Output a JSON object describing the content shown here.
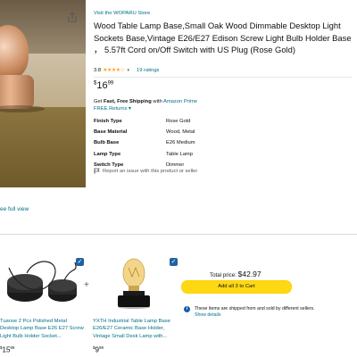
{
  "product": {
    "store_link": "Visit the WOPARU Store",
    "title": "Wood Table Lamp Base,Small Oak Wood Dimmable Desktop Light Sockets Base,Vintage E26/E27 Edison Screw Light Bulb Holder Base ， 5.57ft Cord on/Off Switch with US Plug (Rose Gold)",
    "rating_value": "3.8",
    "rating_stars": "★★★★☆",
    "rating_fraction": 0.76,
    "ratings_count": "19 ratings",
    "price": {
      "symbol": "$",
      "whole": "16",
      "cents": "99"
    },
    "delivery_prefix": "Get ",
    "delivery_bold": "Fast, Free Shipping",
    "delivery_mid": " with ",
    "delivery_prime": "Amazon Prime",
    "returns": "FREE Returns ▾",
    "specs": [
      {
        "key": "Finish Type",
        "value": "Rose Gold"
      },
      {
        "key": "Base Material",
        "value": "Wood, Metal"
      },
      {
        "key": "Bulb Base",
        "value": "E26 Medium"
      },
      {
        "key": "Lamp Type",
        "value": "Table Lamp"
      },
      {
        "key": "Switch Type",
        "value": "Dimmer"
      }
    ],
    "report_issue": "Report an issue with this product or seller",
    "see_full_view": "ee full view"
  },
  "fbt": {
    "items": [
      {
        "title": "Tuanse 2 Pcs Polished Metal Desktop Lamp Base E26 E27 Screw Light Bulb Holder Socket...",
        "price_whole": "15",
        "price_cents": "99",
        "checked": true
      },
      {
        "title": "YXTH Industrial Table Lamp Base E26/E27 Ceramic Base Holder, Vintage Small Desk Lamp with...",
        "price_whole": "9",
        "price_cents": "99",
        "checked": true
      }
    ],
    "plus": "+",
    "total_label": "Total price: ",
    "total_amount": "$42.97",
    "add_button": "Add all 3 to Cart",
    "notice": "These items are shipped from and sold by different sellers.",
    "notice_details": "Show details"
  },
  "icons": {
    "share": "share-icon",
    "flag": "flag-icon",
    "info": "info-icon",
    "check": "checkmark-icon"
  },
  "colors": {
    "link": "#007185",
    "star": "#ffa41c",
    "add_to_cart": "#ffd814",
    "checkbox": "#2162a1"
  }
}
